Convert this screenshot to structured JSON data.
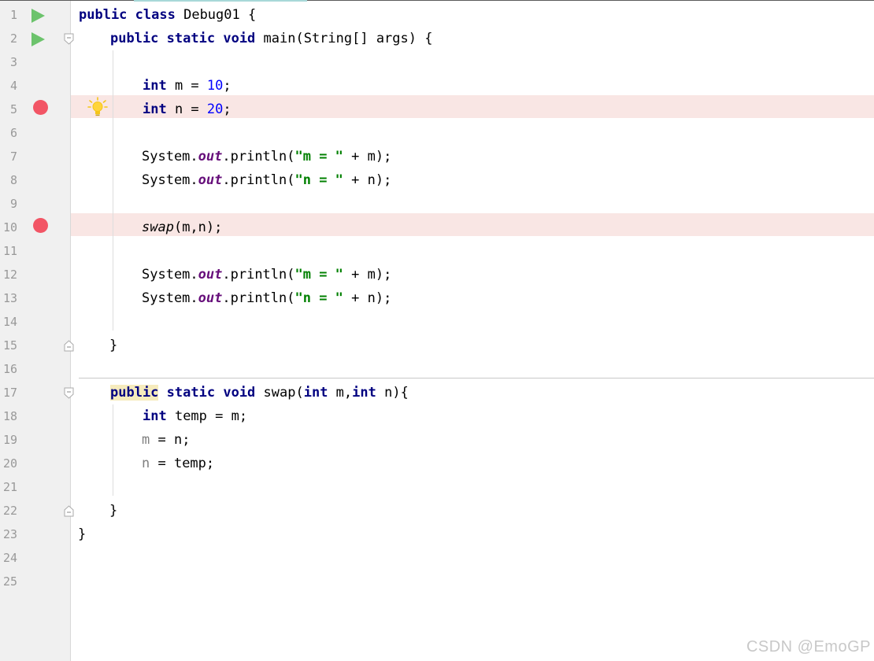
{
  "editor": {
    "lines": [
      {
        "num": "1",
        "tokens": [
          "public",
          " ",
          "class",
          " Debug01 {"
        ]
      },
      {
        "num": "2",
        "tokens": [
          "public",
          " ",
          "static",
          " ",
          "void",
          " main(String[] args) {"
        ]
      },
      {
        "num": "3",
        "tokens": []
      },
      {
        "num": "4",
        "tokens": [
          "int",
          " m = ",
          "10",
          ";"
        ]
      },
      {
        "num": "5",
        "tokens": [
          "int",
          " n = ",
          "20",
          ";"
        ]
      },
      {
        "num": "6",
        "tokens": []
      },
      {
        "num": "7",
        "tokens": [
          "System.",
          "out",
          ".println(",
          "\"m = \"",
          " + m);"
        ]
      },
      {
        "num": "8",
        "tokens": [
          "System.",
          "out",
          ".println(",
          "\"n = \"",
          " + n);"
        ]
      },
      {
        "num": "9",
        "tokens": []
      },
      {
        "num": "10",
        "tokens": [
          "swap",
          "(m,n);"
        ]
      },
      {
        "num": "11",
        "tokens": []
      },
      {
        "num": "12",
        "tokens": [
          "System.",
          "out",
          ".println(",
          "\"m = \"",
          " + m);"
        ]
      },
      {
        "num": "13",
        "tokens": [
          "System.",
          "out",
          ".println(",
          "\"n = \"",
          " + n);"
        ]
      },
      {
        "num": "14",
        "tokens": []
      },
      {
        "num": "15",
        "tokens": [
          "}"
        ]
      },
      {
        "num": "16",
        "tokens": []
      },
      {
        "num": "17",
        "tokens": [
          "public",
          " ",
          "static",
          " ",
          "void",
          " swap(",
          "int",
          " m,",
          "int",
          " n){"
        ]
      },
      {
        "num": "18",
        "tokens": [
          "int",
          " temp = m;"
        ]
      },
      {
        "num": "19",
        "tokens": [
          "m",
          " = n;"
        ]
      },
      {
        "num": "20",
        "tokens": [
          "n",
          " = temp;"
        ]
      },
      {
        "num": "21",
        "tokens": []
      },
      {
        "num": "22",
        "tokens": [
          "}"
        ]
      },
      {
        "num": "23",
        "tokens": [
          "}"
        ]
      },
      {
        "num": "24",
        "tokens": []
      },
      {
        "num": "25",
        "tokens": []
      }
    ],
    "breakpoint_lines": [
      "5",
      "10"
    ],
    "run_lines": [
      "1",
      "2"
    ],
    "gutter_icons": {
      "run": "run-arrow-icon",
      "breakpoint": "breakpoint-icon",
      "fold": "fold-marker-icon",
      "intention": "lightbulb-icon"
    }
  },
  "watermark": "CSDN @EmoGP",
  "colors": {
    "keyword": "#000080",
    "number": "#0000ff",
    "static_field": "#660e7a",
    "string": "#008000",
    "breakpoint": "#f25565",
    "breakpoint_line_bg": "#f9e6e4",
    "run_icon": "#6cc36c"
  }
}
